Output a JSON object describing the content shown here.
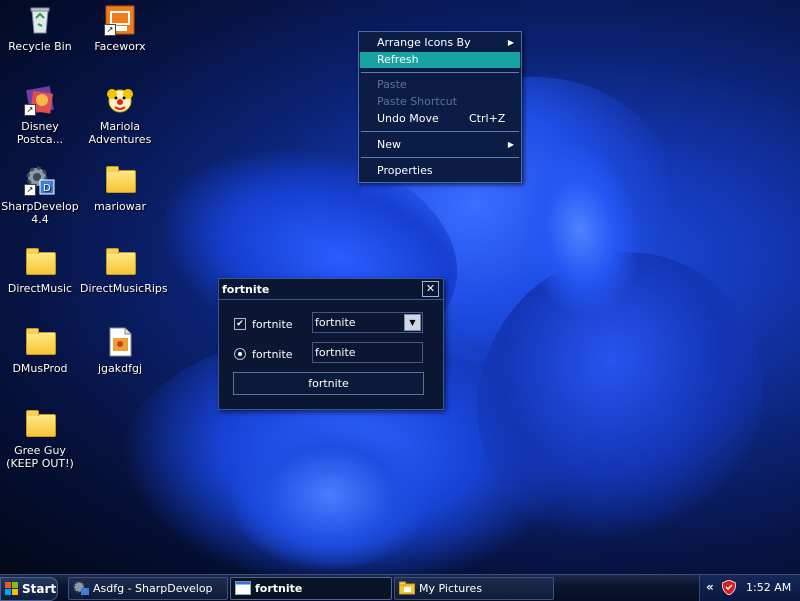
{
  "desktop": {
    "icons": [
      {
        "label": "Recycle Bin",
        "icon": "recycle-bin-icon"
      },
      {
        "label": "Faceworx",
        "icon": "faceworx-icon"
      },
      {
        "label": "Disney Postca...",
        "icon": "disney-icon"
      },
      {
        "label": "Mariola Adventures",
        "icon": "clown-icon"
      },
      {
        "label": "SharpDevelop 4.4",
        "icon": "sharpdevelop-icon"
      },
      {
        "label": "mariowar",
        "icon": "folder-icon"
      },
      {
        "label": "DirectMusic",
        "icon": "folder-icon"
      },
      {
        "label": "DirectMusicRips",
        "icon": "folder-icon"
      },
      {
        "label": "DMusProd",
        "icon": "folder-icon"
      },
      {
        "label": "jgakdfgj",
        "icon": "image-file-icon"
      },
      {
        "label": "Gree Guy (KEEP OUT!)",
        "icon": "folder-icon"
      }
    ]
  },
  "context_menu": {
    "items": [
      {
        "label": "Arrange Icons By",
        "submenu": true
      },
      {
        "label": "Refresh",
        "highlighted": true
      },
      {
        "label": "Paste",
        "disabled": true
      },
      {
        "label": "Paste Shortcut",
        "disabled": true
      },
      {
        "label": "Undo Move",
        "shortcut": "Ctrl+Z"
      },
      {
        "label": "New",
        "submenu": true
      },
      {
        "label": "Properties"
      }
    ]
  },
  "dialog": {
    "title": "fortnite",
    "close_label": "✕",
    "checkbox_label": "fortnite",
    "checkbox_checked": true,
    "combo_value": "fortnite",
    "radio_label": "fortnite",
    "radio_selected": true,
    "textbox_value": "fortnite",
    "button_label": "fortnite"
  },
  "taskbar": {
    "start_label": "Start",
    "buttons": [
      {
        "label": "Asdfg - SharpDevelop",
        "icon": "sharpdevelop-icon",
        "active": false
      },
      {
        "label": "fortnite",
        "icon": "window-icon",
        "active": true
      },
      {
        "label": "My Pictures",
        "icon": "folder-icon",
        "active": false
      }
    ],
    "tray_chevron": "«",
    "clock": "1:52 AM"
  },
  "colors": {
    "menu_highlight": "#17a3a0",
    "menu_bg": "#0b1d45",
    "dialog_bg": "#0a1632"
  }
}
